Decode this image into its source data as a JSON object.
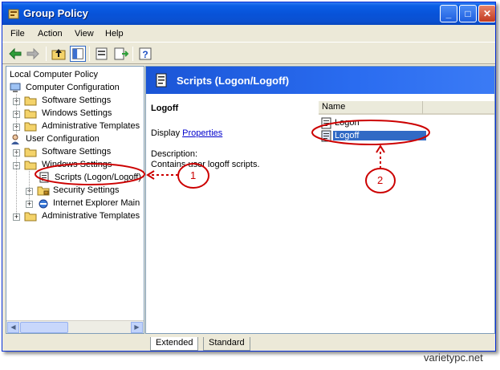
{
  "window": {
    "title": "Group Policy"
  },
  "titlebar_buttons": {
    "minimize": "_",
    "maximize": "□",
    "close": "✕"
  },
  "menu": [
    "File",
    "Action",
    "View",
    "Help"
  ],
  "toolbar_icons": [
    "back-arrow-icon",
    "forward-arrow-icon",
    "up-folder-icon",
    "show-hide-tree-icon",
    "properties-icon",
    "export-list-icon",
    "help-icon"
  ],
  "tree": {
    "root": "Local Computer Policy",
    "computer_config": "Computer Configuration",
    "cc_software": "Software Settings",
    "cc_windows": "Windows Settings",
    "cc_admin": "Administrative Templates",
    "user_config": "User Configuration",
    "uc_software": "Software Settings",
    "uc_windows": "Windows Settings",
    "uc_scripts": "Scripts (Logon/Logoff)",
    "uc_security": "Security Settings",
    "uc_ie": "Internet Explorer Main",
    "uc_admin": "Administrative Templates",
    "expander_plus": "+",
    "expander_minus": "−"
  },
  "right_pane": {
    "header": "Scripts (Logon/Logoff)",
    "desc_title": "Logoff",
    "display_prefix": "Display ",
    "display_link": "Properties",
    "desc_label": "Description:",
    "desc_text": "Contains user logoff scripts."
  },
  "list": {
    "column_name": "Name",
    "items": [
      "Logon",
      "Logoff"
    ],
    "selected": "Logoff"
  },
  "tabs": [
    "Extended",
    "Standard"
  ],
  "annotations": {
    "one": "1",
    "two": "2"
  },
  "watermark": "varietypc.net",
  "colors": {
    "title_blue": "#0853d9",
    "selection": "#316ac5",
    "annotation_red": "#cc0000"
  }
}
